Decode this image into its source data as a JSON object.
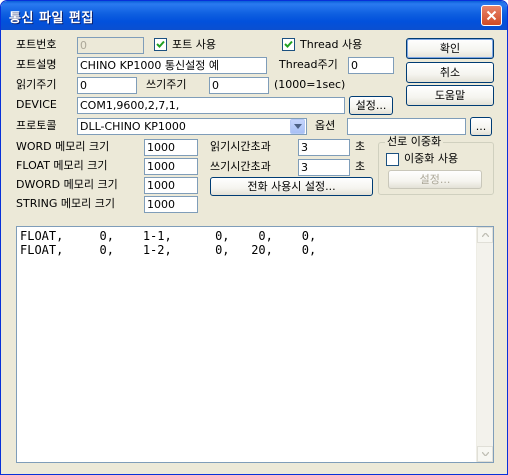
{
  "window": {
    "title": "통신 파일 편집"
  },
  "port": {
    "number_label": "포트번호",
    "number_value": "0",
    "use_label": "포트 사용",
    "desc_label": "포트설명",
    "desc_value": "CHINO KP1000 통신설정 예",
    "read_period_label": "읽기주기",
    "read_period_value": "0",
    "write_period_label": "쓰기주기",
    "write_period_value": "0",
    "period_unit": "(1000=1sec)",
    "device_label": "DEVICE",
    "device_value": "COM1,9600,2,7,1,",
    "protocol_label": "프로토콜",
    "protocol_value": "DLL-CHINO KP1000",
    "option_label": "옵션",
    "option_value": ""
  },
  "thread": {
    "use_label": "Thread 사용",
    "period_label": "Thread주기",
    "period_value": "0"
  },
  "buttons": {
    "ok": "확인",
    "cancel": "취소",
    "help": "도움말",
    "device_setup": "설정...",
    "option_more": "...",
    "phone_setup": "전화 사용시 설정...",
    "dual_setup": "설정..."
  },
  "memory": {
    "word_label": "WORD 메모리 크기",
    "word_value": "1000",
    "float_label": "FLOAT 메모리 크기",
    "float_value": "1000",
    "dword_label": "DWORD 메모리 크기",
    "dword_value": "1000",
    "string_label": "STRING 메모리 크기",
    "string_value": "1000"
  },
  "timeouts": {
    "read_label": "읽기시간초과",
    "read_value": "3",
    "write_label": "쓰기시간초과",
    "write_value": "3",
    "unit": "초"
  },
  "dual_line": {
    "group_title": "선로 이중화",
    "use_label": "이중화 사용"
  },
  "editor": {
    "lines": [
      "FLOAT,     0,    1-1,      0,    0,    0,",
      "FLOAT,     0,    1-2,      0,   20,    0,"
    ]
  },
  "icons": {
    "close": "close-icon",
    "combo": "chevron-down-icon",
    "scroll_up": "scroll-up-icon",
    "scroll_down": "scroll-down-icon"
  }
}
